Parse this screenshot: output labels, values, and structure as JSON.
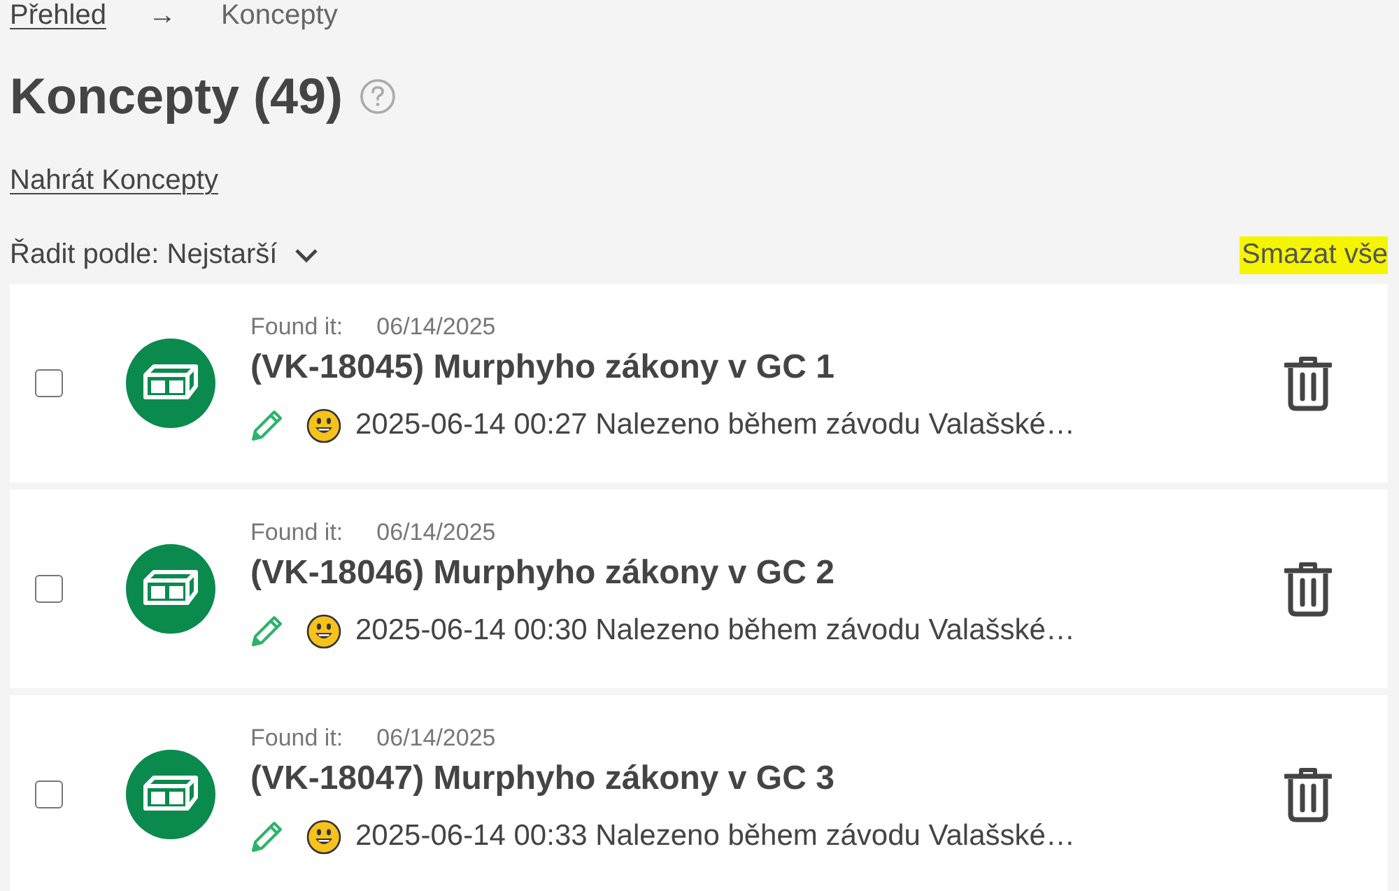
{
  "breadcrumb": {
    "link": "Přehled",
    "separator": "→",
    "current": "Koncepty"
  },
  "page_title": "Koncepty (49)",
  "upload_link": "Nahrát Koncepty",
  "sort": {
    "label": "Řadit podle: Nejstarší"
  },
  "delete_all": {
    "label": "Smazat vše",
    "highlighted": true
  },
  "drafts": [
    {
      "checked": false,
      "found_label": "Found it:",
      "found_date": "06/14/2025",
      "title": "(VK-18045) Murphyho zákony v GC 1",
      "log_text": "2025-06-14 00:27 Nalezeno během závodu Valašské…"
    },
    {
      "checked": false,
      "found_label": "Found it:",
      "found_date": "06/14/2025",
      "title": "(VK-18046) Murphyho zákony v GC 2",
      "log_text": "2025-06-14 00:30 Nalezeno během závodu Valašské…"
    },
    {
      "checked": false,
      "found_label": "Found it:",
      "found_date": "06/14/2025",
      "title": "(VK-18047) Murphyho zákony v GC 3",
      "log_text": "2025-06-14 00:33 Nalezeno během závodu Valašské…"
    }
  ]
}
